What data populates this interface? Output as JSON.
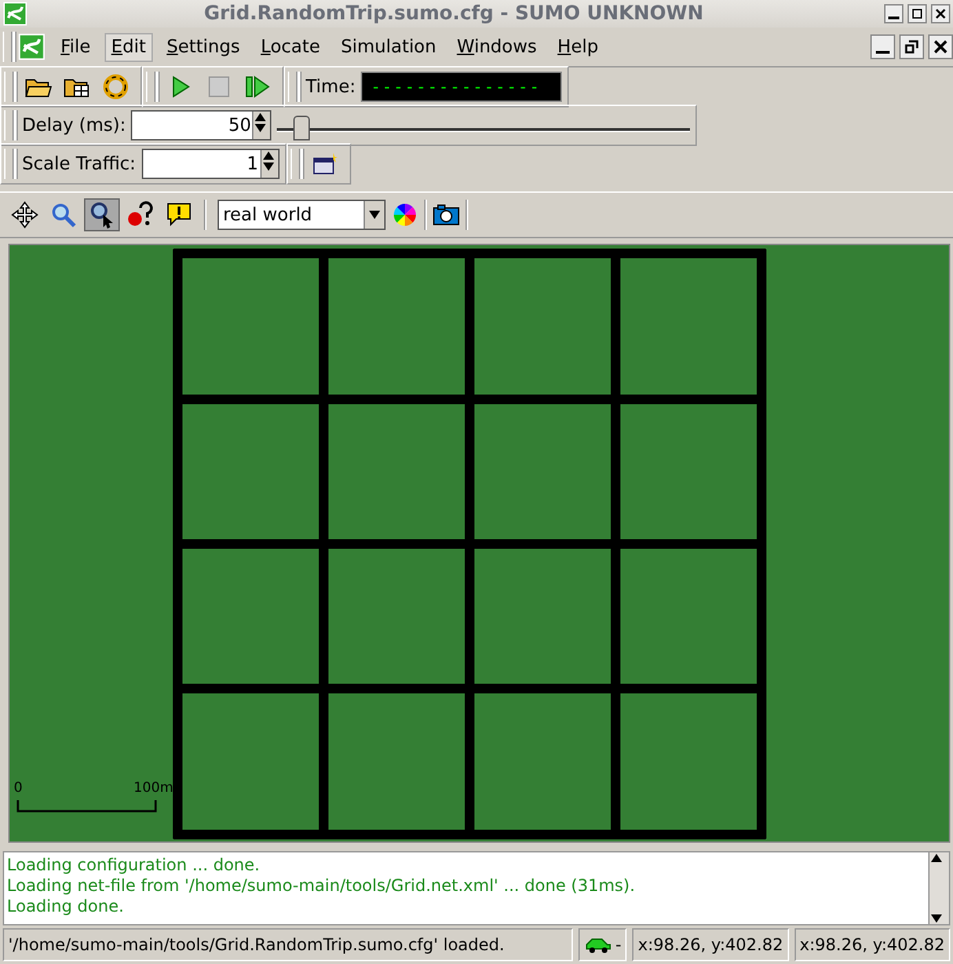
{
  "window": {
    "title": "Grid.RandomTrip.sumo.cfg - SUMO UNKNOWN"
  },
  "menu": [
    {
      "label": "File",
      "underlined": true,
      "selected": false
    },
    {
      "label": "Edit",
      "underlined": true,
      "selected": true
    },
    {
      "label": "Settings",
      "underlined": true,
      "selected": false
    },
    {
      "label": "Locate",
      "underlined": true,
      "selected": false
    },
    {
      "label": "Simulation",
      "underlined": false,
      "selected": false
    },
    {
      "label": "Windows",
      "underlined": true,
      "selected": false
    },
    {
      "label": "Help",
      "underlined": true,
      "selected": false
    }
  ],
  "time": {
    "label": "Time:",
    "value": "---------------"
  },
  "delay": {
    "label": "Delay (ms):",
    "value": "50",
    "level": 0.04
  },
  "scale_traffic": {
    "label": "Scale Traffic:",
    "value": "1"
  },
  "view_tools": [
    {
      "kind": "recenter",
      "selected": false
    },
    {
      "kind": "zoom",
      "selected": false
    },
    {
      "kind": "locate",
      "selected": true
    },
    {
      "kind": "query",
      "selected": false
    },
    {
      "kind": "warning",
      "selected": false
    }
  ],
  "scheme": {
    "value": "real world"
  },
  "scale_bar": {
    "start": "0",
    "end": "100m"
  },
  "messages": [
    "Loading configuration ... done.",
    "Loading net-file from '/home/sumo-main/tools/Grid.net.xml' ... done (31ms).",
    "Loading done."
  ],
  "status_bar": {
    "message": "'/home/sumo-main/tools/Grid.RandomTrip.sumo.cfg' loaded.",
    "vehicle_count": "-",
    "coords_1": "x:98.26, y:402.82",
    "coords_2": "x:98.26, y:402.82"
  }
}
